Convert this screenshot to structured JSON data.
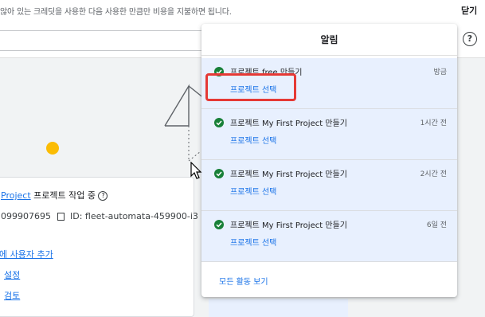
{
  "banner": {
    "text": "않아 있는 크레딧을 사용한 다음 사용한 만큼만 비용을 지불하면 됩니다.",
    "close_label": "닫기"
  },
  "header": {
    "help_icon": "help-circle-icon",
    "help_label": "?"
  },
  "card": {
    "project_link": "Project",
    "project_status": "프로젝트 작업 중",
    "project_number": "099907695",
    "project_id": "ID: fleet-automata-459900-i3",
    "links": [
      "에 사용자 추가",
      "설정",
      "검토"
    ]
  },
  "notifications_panel": {
    "title": "알림",
    "items": [
      {
        "title": "프로젝트 free 만들기",
        "time": "방금",
        "action": "프로젝트 선택"
      },
      {
        "title": "프로젝트 My First Project 만들기",
        "time": "1시간 전",
        "action": "프로젝트 선택"
      },
      {
        "title": "프로젝트 My First Project 만들기",
        "time": "2시간 전",
        "action": "프로젝트 선택"
      },
      {
        "title": "프로젝트 My First Project 만들기",
        "time": "6일 전",
        "action": "프로젝트 선택"
      }
    ],
    "all_activity_label": "모든 활동 보기"
  },
  "colors": {
    "accent": "#1a73e8",
    "success": "#188038",
    "highlight": "#e53935",
    "notification_bg": "#e8f0fe"
  }
}
